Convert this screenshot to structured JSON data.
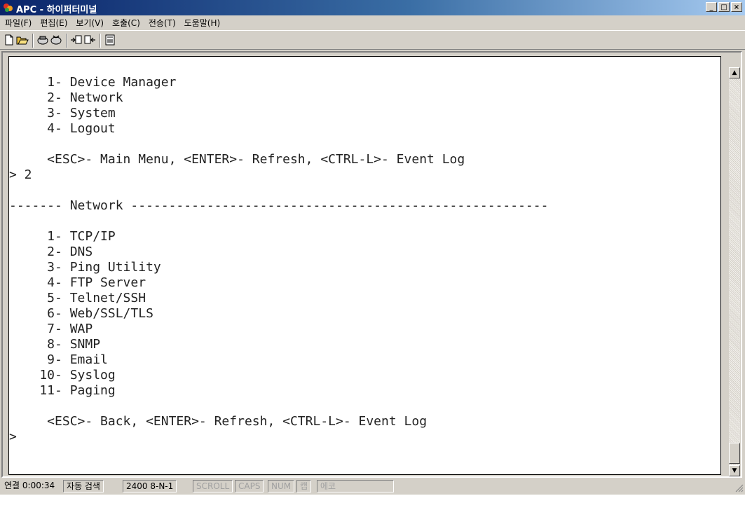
{
  "window": {
    "title": "APC - 하이퍼터미널",
    "minimize_label": "_",
    "maximize_label": "□",
    "close_label": "×"
  },
  "menu": [
    "파일(F)",
    "편집(E)",
    "보기(V)",
    "호출(C)",
    "전송(T)",
    "도움말(H)"
  ],
  "toolbar": {
    "buttons": [
      "new-icon",
      "open-icon",
      "connect-icon",
      "disconnect-icon",
      "send-icon",
      "receive-icon",
      "properties-icon"
    ]
  },
  "terminal": {
    "lines": [
      "     1- Device Manager",
      "     2- Network",
      "     3- System",
      "     4- Logout",
      "",
      "     <ESC>- Main Menu, <ENTER>- Refresh, <CTRL-L>- Event Log",
      "> 2",
      "",
      "------- Network -------------------------------------------------------",
      "",
      "     1- TCP/IP",
      "     2- DNS",
      "     3- Ping Utility",
      "     4- FTP Server",
      "     5- Telnet/SSH",
      "     6- Web/SSL/TLS",
      "     7- WAP",
      "     8- SNMP",
      "     9- Email",
      "    10- Syslog",
      "    11- Paging",
      "",
      "     <ESC>- Back, <ENTER>- Refresh, <CTRL-L>- Event Log",
      ">"
    ]
  },
  "status": {
    "connection": "연결 0:00:34",
    "detect": "자동 검색",
    "settings": "2400 8-N-1",
    "scroll": "SCROLL",
    "caps": "CAPS",
    "num": "NUM",
    "capture": "캡",
    "print": "에코"
  }
}
